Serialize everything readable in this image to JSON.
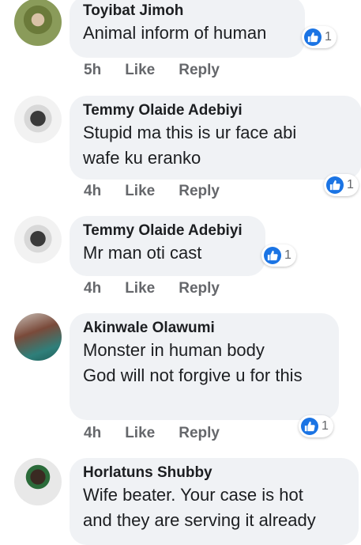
{
  "comments": [
    {
      "name": "Toyibat Jimoh",
      "lines": [
        "Animal inform of human"
      ],
      "time": "5h",
      "like": "Like",
      "reply": "Reply",
      "reactions": "1"
    },
    {
      "name": "Temmy Olaide Adebiyi",
      "lines": [
        "Stupid ma this is ur face abi",
        "wafe ku eranko"
      ],
      "time": "4h",
      "like": "Like",
      "reply": "Reply",
      "reactions": "1"
    },
    {
      "name": "Temmy Olaide Adebiyi",
      "lines": [
        "Mr man oti cast"
      ],
      "time": "4h",
      "like": "Like",
      "reply": "Reply",
      "reactions": "1"
    },
    {
      "name": "Akinwale Olawumi",
      "lines": [
        "Monster in human body",
        "God will not forgive u for this"
      ],
      "time": "4h",
      "like": "Like",
      "reply": "Reply",
      "reactions": "1"
    },
    {
      "name": "Horlatuns Shubby",
      "lines": [
        "Wife beater. Your case is hot",
        "and they are serving it already"
      ]
    }
  ],
  "icons": {
    "reaction": "like-thumb-icon"
  },
  "colors": {
    "bubble": "#f0f2f5",
    "like_blue": "#1b74e4",
    "meta_gray": "#65676b"
  }
}
